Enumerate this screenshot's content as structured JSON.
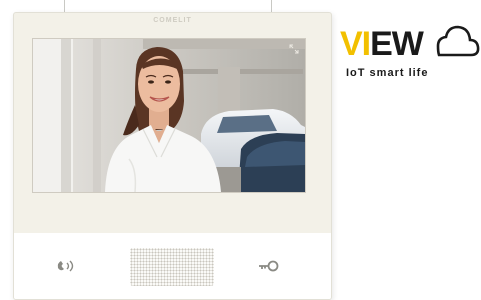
{
  "device": {
    "brand": "COMELIT",
    "buttons": [
      {
        "name": "answer-call",
        "icon": "handset-icon"
      },
      {
        "name": "door-release",
        "icon": "key-icon"
      }
    ]
  },
  "logo": {
    "word_accent": "VI",
    "word_rest": "EW",
    "tagline": "IoT smart life",
    "colors": {
      "accent": "#f2c000",
      "text": "#1a1a1a"
    }
  },
  "screen": {
    "content": "woman smiling in white shirt in front of a parking area with cars",
    "icon": "expand-icon"
  },
  "colors": {
    "bezel": "#f3f1e8",
    "panel": "#ffffff",
    "icons": "#8a8a84"
  }
}
